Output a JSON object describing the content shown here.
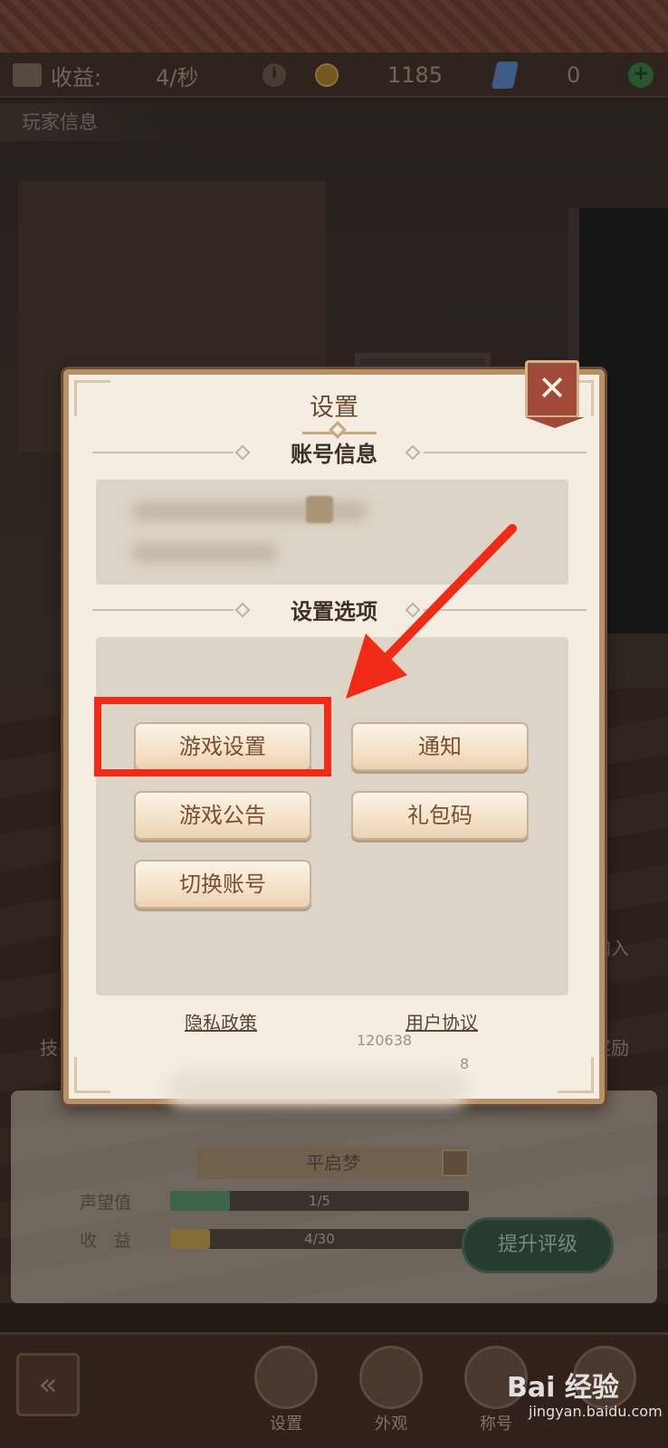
{
  "status_bar": {
    "income_label": "收益:",
    "income_rate": "4/秒",
    "coins": "1185",
    "gems": "0"
  },
  "player_info_label": "玩家信息",
  "side_labels": {
    "join": "加入",
    "reward": "奖励",
    "left_partial": "技"
  },
  "lower_panel": {
    "name": "平启梦",
    "reputation_label": "声望值",
    "reputation_value": "1/5",
    "reputation_fraction": 0.2,
    "income_label": "收　益",
    "income_value": "4/30",
    "income_fraction": 0.1333,
    "upgrade_button": "提升评级"
  },
  "bottom_nav": {
    "back_glyph": "«",
    "items": [
      {
        "label": "设置"
      },
      {
        "label": "外观"
      },
      {
        "label": "称号"
      }
    ]
  },
  "dialog": {
    "title": "设置",
    "close_glyph": "✕",
    "account_section": "账号信息",
    "options_section": "设置选项",
    "options": {
      "game_settings": "游戏设置",
      "notify": "通知",
      "announcement": "游戏公告",
      "gift_code": "礼包码",
      "switch_account": "切换账号"
    },
    "privacy_link": "隐私政策",
    "user_agreement_link": "用户协议",
    "version_partial": "120638",
    "version_partial2": "8"
  },
  "watermark": {
    "brand": "Bai 经验",
    "url": "jingyan.baidu.com"
  },
  "colors": {
    "highlight": "#f02a14",
    "dialog_bg": "#f3ede2",
    "button_text": "#7a4f31"
  }
}
